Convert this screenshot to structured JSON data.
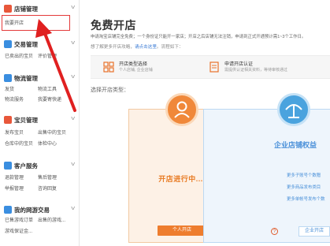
{
  "sidebar": {
    "sections": [
      {
        "title": "店铺管理",
        "icon": "store-icon",
        "color": "#e8573a",
        "items": [
          "我要开店"
        ]
      },
      {
        "title": "交易管理",
        "icon": "trade-icon",
        "color": "#3a8ee0",
        "items": [
          "已卖出的宝贝",
          "评价管理"
        ]
      },
      {
        "title": "物流管理",
        "icon": "truck-icon",
        "color": "#3a8ee0",
        "items": [
          "发货",
          "物流工具",
          "物流服务",
          "我要寄快递"
        ]
      },
      {
        "title": "宝贝管理",
        "icon": "goods-icon",
        "color": "#e8573a",
        "items": [
          "发布宝贝",
          "出售中的宝贝",
          "仓库中的宝贝",
          "体检中心"
        ]
      },
      {
        "title": "客户服务",
        "icon": "service-icon",
        "color": "#3a8ee0",
        "items": [
          "退款管理",
          "售后管理",
          "举报管理",
          "咨询回复"
        ]
      },
      {
        "title": "我的网游交易",
        "icon": "game-icon",
        "color": "#3a8ee0",
        "items": [
          "已售游戏订单",
          "出售的游戏...",
          "游戏保证金..."
        ]
      }
    ]
  },
  "main": {
    "title": "免费开店",
    "note1": "申请淘宝店铺完全免费；一个身份证只能开一家店；开店之后店铺无法注销，申请到正式开通预计需1~3个工作日。",
    "note2_prefix": "想了解更多开店攻略，",
    "note2_link": "请点击这里",
    "note2_suffix": "。流程如下：",
    "steps": [
      {
        "title": "开店类型选择",
        "desc": "个人店铺, 企业店铺"
      },
      {
        "title": "申请开店认证",
        "desc": "需提供认证相关资料，等待审核通过"
      }
    ],
    "choose_label": "选择开店类型：",
    "personal_card": {
      "status": "开店进行中...",
      "button": "个人开店"
    },
    "corp_card": {
      "title": "企业店铺权益",
      "lines": [
        "更多子账号个数赠",
        "更多商品发布类目",
        "更多单帐号发布个数"
      ],
      "help": "?",
      "button": "企业开店"
    }
  },
  "colors": {
    "accent_orange": "#ee7d2e",
    "accent_blue": "#4a90d9",
    "highlight_red": "#e33a3a"
  }
}
